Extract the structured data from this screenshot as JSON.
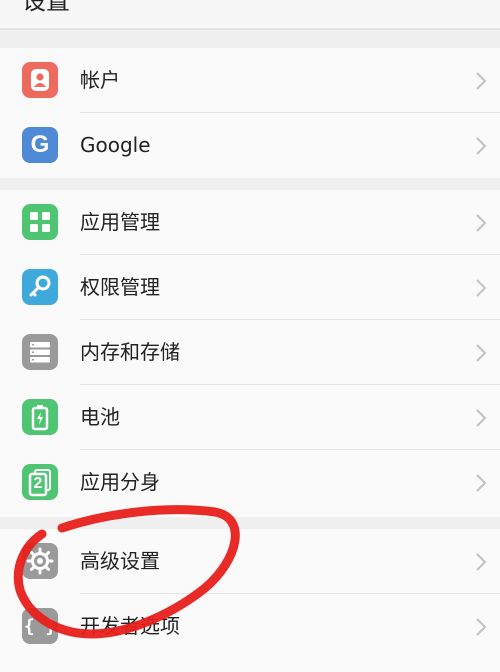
{
  "header": {
    "title": "设置"
  },
  "colors": {
    "account": "#ee6a5f",
    "google": "#4e8ad6",
    "app_manage": "#4fc472",
    "permission": "#3fa9dc",
    "storage": "#9a9a9a",
    "battery": "#4fc472",
    "app_twin": "#4fc472",
    "advanced": "#9a9a9a",
    "developer": "#9a9a9a",
    "annotation": "#e8201b"
  },
  "items": [
    {
      "label": "帐户",
      "icon": "account-icon"
    },
    {
      "label": "Google",
      "icon": "google-icon",
      "icon_letter": "G"
    },
    {
      "label": "应用管理",
      "icon": "app-management-icon"
    },
    {
      "label": "权限管理",
      "icon": "permission-key-icon"
    },
    {
      "label": "内存和存储",
      "icon": "storage-icon"
    },
    {
      "label": "电池",
      "icon": "battery-icon"
    },
    {
      "label": "应用分身",
      "icon": "app-twin-icon",
      "icon_letter": "2"
    },
    {
      "label": "高级设置",
      "icon": "gear-icon"
    },
    {
      "label": "开发者选项",
      "icon": "developer-braces-icon",
      "icon_letter": "{ }"
    }
  ]
}
